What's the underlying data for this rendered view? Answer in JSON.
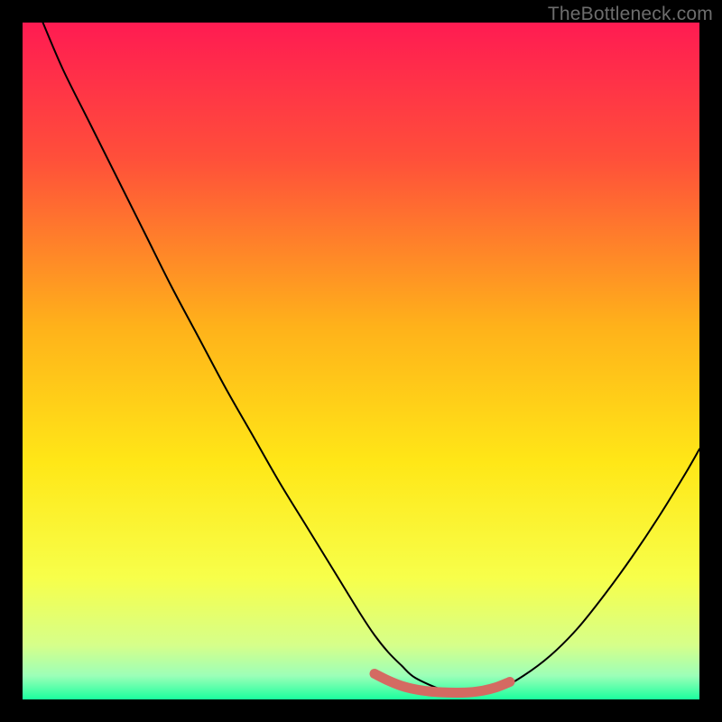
{
  "watermark": "TheBottleneck.com",
  "chart_data": {
    "type": "line",
    "title": "",
    "xlabel": "",
    "ylabel": "",
    "xlim": [
      0,
      100
    ],
    "ylim": [
      0,
      100
    ],
    "grid": false,
    "legend": false,
    "background_gradient_stops": [
      {
        "offset": 0.0,
        "color": "#ff1b52"
      },
      {
        "offset": 0.2,
        "color": "#ff4f3a"
      },
      {
        "offset": 0.45,
        "color": "#ffb21a"
      },
      {
        "offset": 0.65,
        "color": "#ffe717"
      },
      {
        "offset": 0.82,
        "color": "#f7ff4a"
      },
      {
        "offset": 0.92,
        "color": "#d6ff8a"
      },
      {
        "offset": 0.965,
        "color": "#9cffb8"
      },
      {
        "offset": 1.0,
        "color": "#1bff9e"
      }
    ],
    "series": [
      {
        "name": "curve",
        "color": "#000000",
        "stroke_width": 2,
        "x": [
          3,
          6,
          10,
          14,
          18,
          22,
          26,
          30,
          34,
          38,
          42,
          46,
          50,
          52,
          54,
          56,
          58,
          62,
          64,
          67,
          70,
          74,
          78,
          82,
          86,
          90,
          94,
          98,
          100
        ],
        "y": [
          100,
          93,
          85,
          77,
          69,
          61,
          53.5,
          46,
          39,
          32,
          25.5,
          19,
          12.5,
          9.5,
          7,
          5,
          3.2,
          1.4,
          1.0,
          1.0,
          1.3,
          3.5,
          6.5,
          10.5,
          15.5,
          21,
          27,
          33.5,
          37
        ]
      },
      {
        "name": "bottom-highlight",
        "color": "#d46a62",
        "stroke_width": 11,
        "linecap": "round",
        "x": [
          52,
          54,
          56,
          58,
          60,
          62,
          64,
          66,
          68,
          70,
          72
        ],
        "y": [
          3.8,
          2.8,
          2.0,
          1.5,
          1.2,
          1.05,
          1.0,
          1.05,
          1.3,
          1.8,
          2.6
        ]
      }
    ]
  }
}
